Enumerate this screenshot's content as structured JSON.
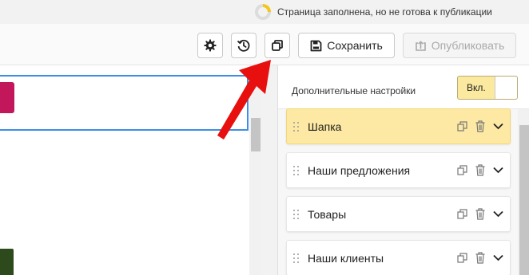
{
  "status": {
    "text": "Страница заполнена, но не готова к публикации",
    "icon": "progress-ring-icon",
    "ring_color": "#f4c51a",
    "progress_fraction": 0.25
  },
  "toolbar": {
    "settings_icon": "gear-icon",
    "history_icon": "history-icon",
    "duplicate_icon": "copy-icon",
    "save_label": "Сохранить",
    "save_icon": "floppy-disk-icon",
    "publish_label": "Опубликовать",
    "publish_icon": "upload-icon"
  },
  "panel": {
    "title": "Дополнительные настройки",
    "toggle_label": "Вкл.",
    "toggle_on": true,
    "sections": [
      {
        "label": "Шапка",
        "active": true
      },
      {
        "label": "Наши предложения",
        "active": false
      },
      {
        "label": "Товары",
        "active": false
      },
      {
        "label": "Наши клиенты",
        "active": false
      }
    ]
  },
  "colors": {
    "accent_yellow": "#fde9a3",
    "selection_blue": "#3d8fe6",
    "magenta": "#c2175b",
    "arrow_red": "#e8100f"
  }
}
